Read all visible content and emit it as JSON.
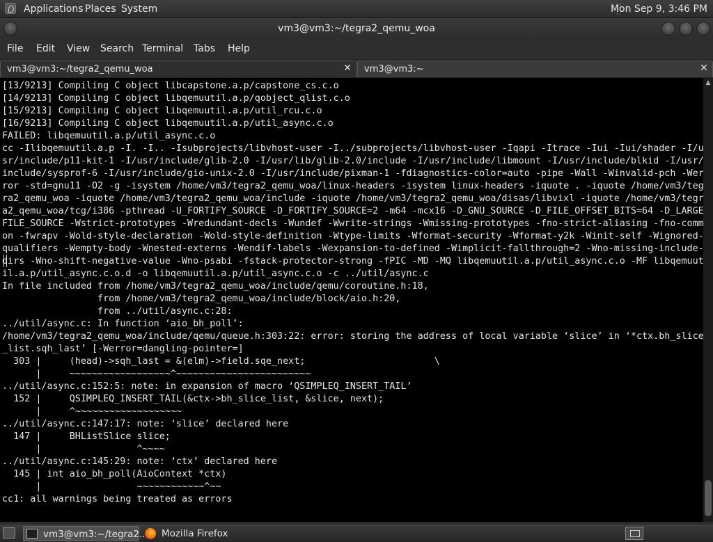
{
  "top_panel": {
    "menus": [
      "Applications",
      "Places",
      "System"
    ],
    "clock": "Mon Sep  9,  3:46 PM"
  },
  "window": {
    "title": "vm3@vm3:~/tegra2_qemu_woa"
  },
  "menubar": {
    "items": [
      "File",
      "Edit",
      "View",
      "Search",
      "Terminal",
      "Tabs",
      "Help"
    ]
  },
  "tabs": [
    {
      "label": "vm3@vm3:~/tegra2_qemu_woa",
      "active": true
    },
    {
      "label": "vm3@vm3:~",
      "active": false
    }
  ],
  "terminal": {
    "lines": [
      "[13/9213] Compiling C object libcapstone.a.p/capstone_cs.c.o",
      "[14/9213] Compiling C object libqemuutil.a.p/qobject_qlist.c.o",
      "[15/9213] Compiling C object libqemuutil.a.p/util_rcu.c.o",
      "[16/9213] Compiling C object libqemuutil.a.p/util_async.c.o",
      "FAILED: libqemuutil.a.p/util_async.c.o",
      "cc -Ilibqemuutil.a.p -I. -I.. -Isubprojects/libvhost-user -I../subprojects/libvhost-user -Iqapi -Itrace -Iui -Iui/shader -I/u",
      "sr/include/p11-kit-1 -I/usr/include/glib-2.0 -I/usr/lib/glib-2.0/include -I/usr/include/libmount -I/usr/include/blkid -I/usr/",
      "include/sysprof-6 -I/usr/include/gio-unix-2.0 -I/usr/include/pixman-1 -fdiagnostics-color=auto -pipe -Wall -Winvalid-pch -Wer",
      "ror -std=gnu11 -O2 -g -isystem /home/vm3/tegra2_qemu_woa/linux-headers -isystem linux-headers -iquote . -iquote /home/vm3/teg",
      "ra2_qemu_woa -iquote /home/vm3/tegra2_qemu_woa/include -iquote /home/vm3/tegra2_qemu_woa/disas/libvixl -iquote /home/vm3/tegr",
      "a2_qemu_woa/tcg/i386 -pthread -U_FORTIFY_SOURCE -D_FORTIFY_SOURCE=2 -m64 -mcx16 -D_GNU_SOURCE -D_FILE_OFFSET_BITS=64 -D_LARGE",
      "FILE_SOURCE -Wstrict-prototypes -Wredundant-decls -Wundef -Wwrite-strings -Wmissing-prototypes -fno-strict-aliasing -fno-comm",
      "on -fwrapv -Wold-style-declaration -Wold-style-definition -Wtype-limits -Wformat-security -Wformat-y2k -Winit-self -Wignored-",
      "qualifiers -Wempty-body -Wnested-externs -Wendif-labels -Wexpansion-to-defined -Wimplicit-fallthrough=2 -Wno-missing-include-",
      "dirs -Wno-shift-negative-value -Wno-psabi -fstack-protector-strong -fPIC -MD -MQ libqemuutil.a.p/util_async.c.o -MF libqemuut",
      "il.a.p/util_async.c.o.d -o libqemuutil.a.p/util_async.c.o -c ../util/async.c",
      "In file included from /home/vm3/tegra2_qemu_woa/include/qemu/coroutine.h:18,",
      "                 from /home/vm3/tegra2_qemu_woa/include/block/aio.h:20,",
      "                 from ../util/async.c:28:",
      "../util/async.c: In function ‘aio_bh_poll’:",
      "/home/vm3/tegra2_qemu_woa/include/qemu/queue.h:303:22: error: storing the address of local variable ‘slice’ in ‘*ctx.bh_slice",
      "_list.sqh_last’ [-Werror=dangling-pointer=]",
      "  303 |     (head)->sqh_last = &(elm)->field.sqe_next;                       \\",
      "      |     ~~~~~~~~~~~~~~~~~~^~~~~~~~~~~~~~~~~~~~~~~~~",
      "../util/async.c:152:5: note: in expansion of macro ‘QSIMPLEQ_INSERT_TAIL’",
      "  152 |     QSIMPLEQ_INSERT_TAIL(&ctx->bh_slice_list, &slice, next);",
      "      |     ^~~~~~~~~~~~~~~~~~~~",
      "../util/async.c:147:17: note: ‘slice’ declared here",
      "  147 |     BHListSlice slice;",
      "      |                 ^~~~~",
      "../util/async.c:145:29: note: ‘ctx’ declared here",
      "  145 | int aio_bh_poll(AioContext *ctx)",
      "      |                 ~~~~~~~~~~~~^~~",
      "cc1: all warnings being treated as errors"
    ]
  },
  "taskbar": {
    "tasks": [
      {
        "label": "vm3@vm3:~/tegra2...",
        "icon": "terminal-icon"
      },
      {
        "label": "Mozilla Firefox",
        "icon": "firefox-icon"
      }
    ]
  }
}
